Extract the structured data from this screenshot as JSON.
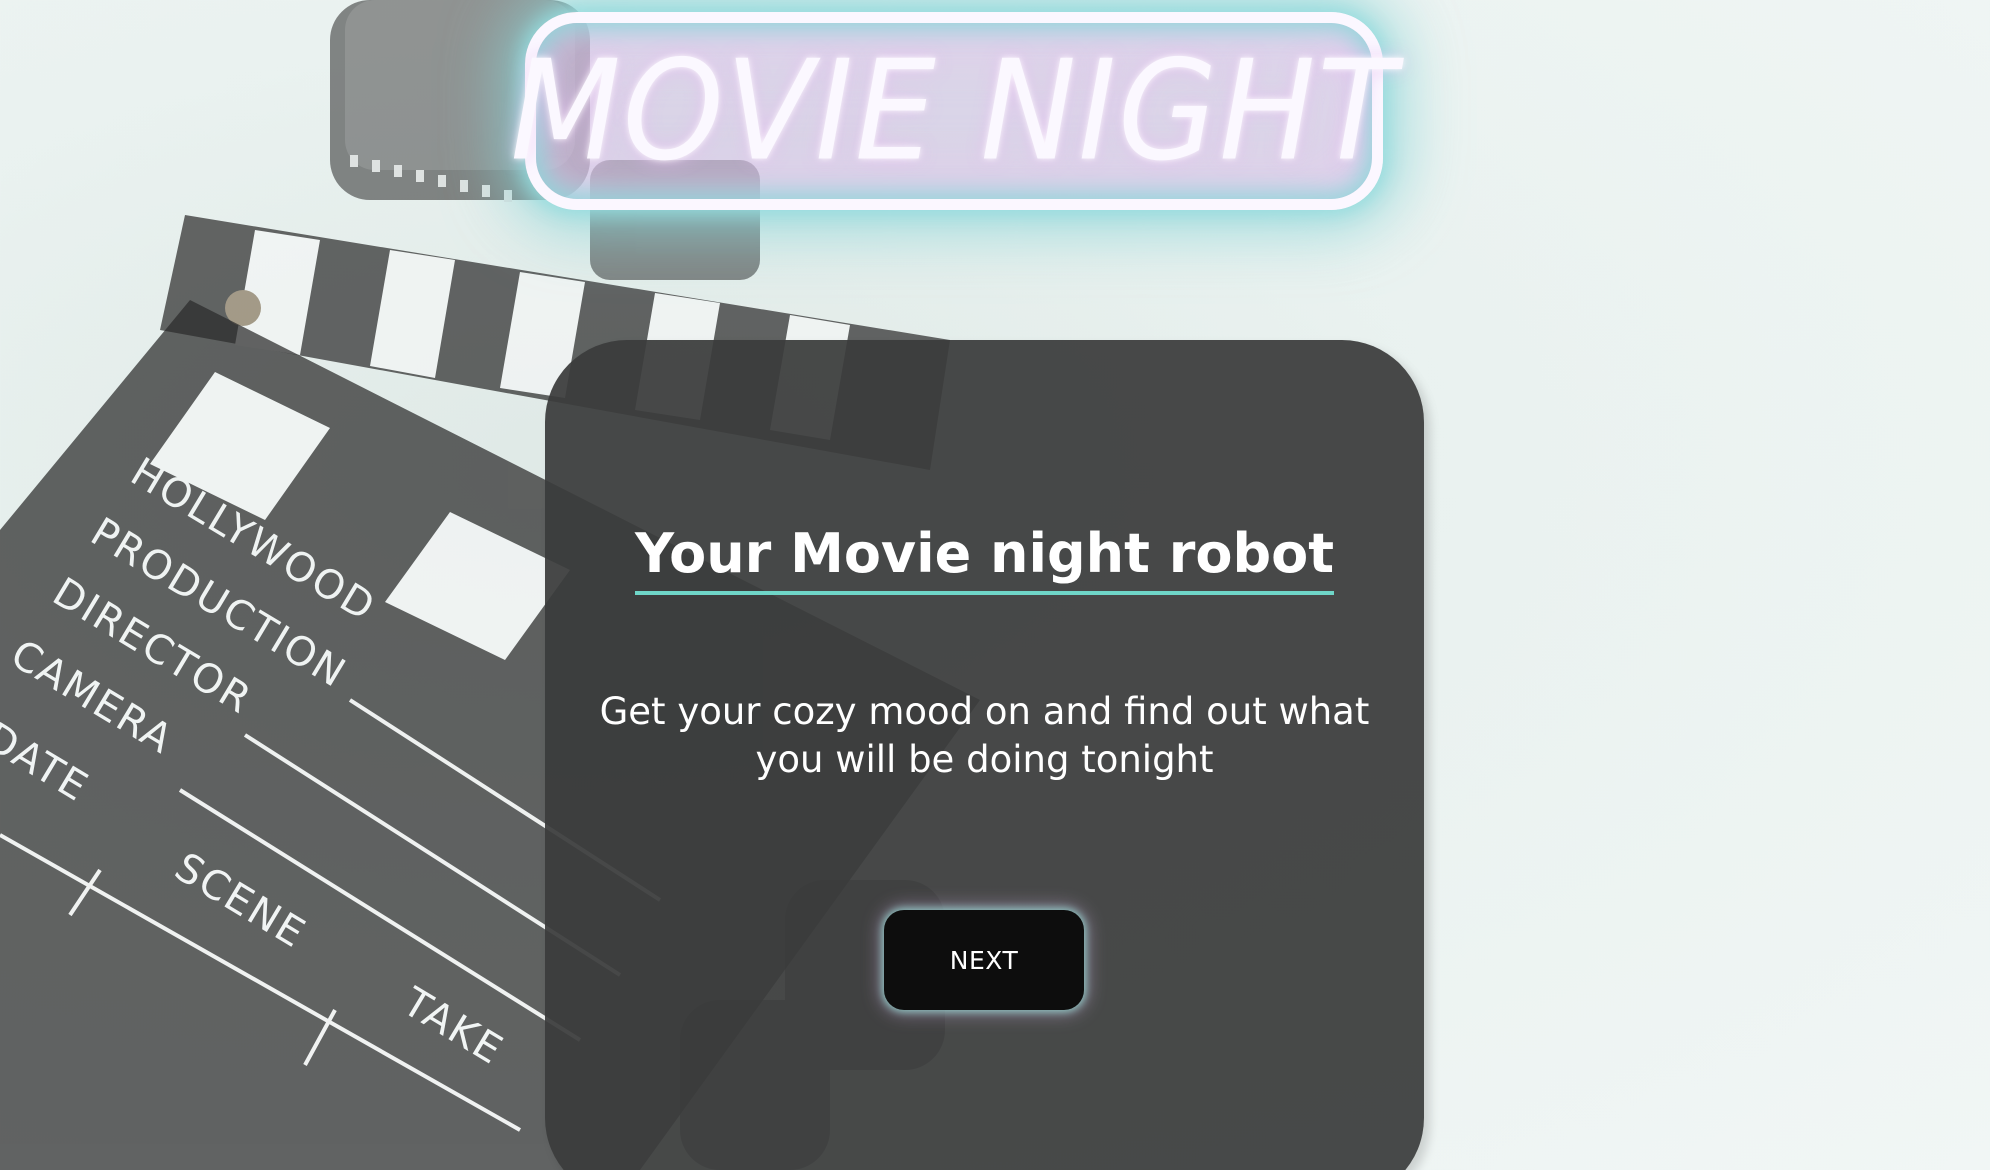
{
  "header": {
    "sign_text": "MOVIE NIGHT"
  },
  "card": {
    "title": "Your Movie night robot",
    "description": "Get your cozy mood on and find out what you will be doing tonight",
    "next_button_label": "NEXT"
  },
  "background": {
    "clapperboard_labels": [
      "HOLLYWOOD",
      "PRODUCTION",
      "DIRECTOR",
      "CAMERA",
      "DATE",
      "SCENE",
      "TAKE"
    ]
  },
  "colors": {
    "card_background": "#3a3b3b",
    "accent_underline": "#6fd6c8",
    "neon_glow": "#8cd6d8",
    "button_background": "#0d0d0d"
  }
}
